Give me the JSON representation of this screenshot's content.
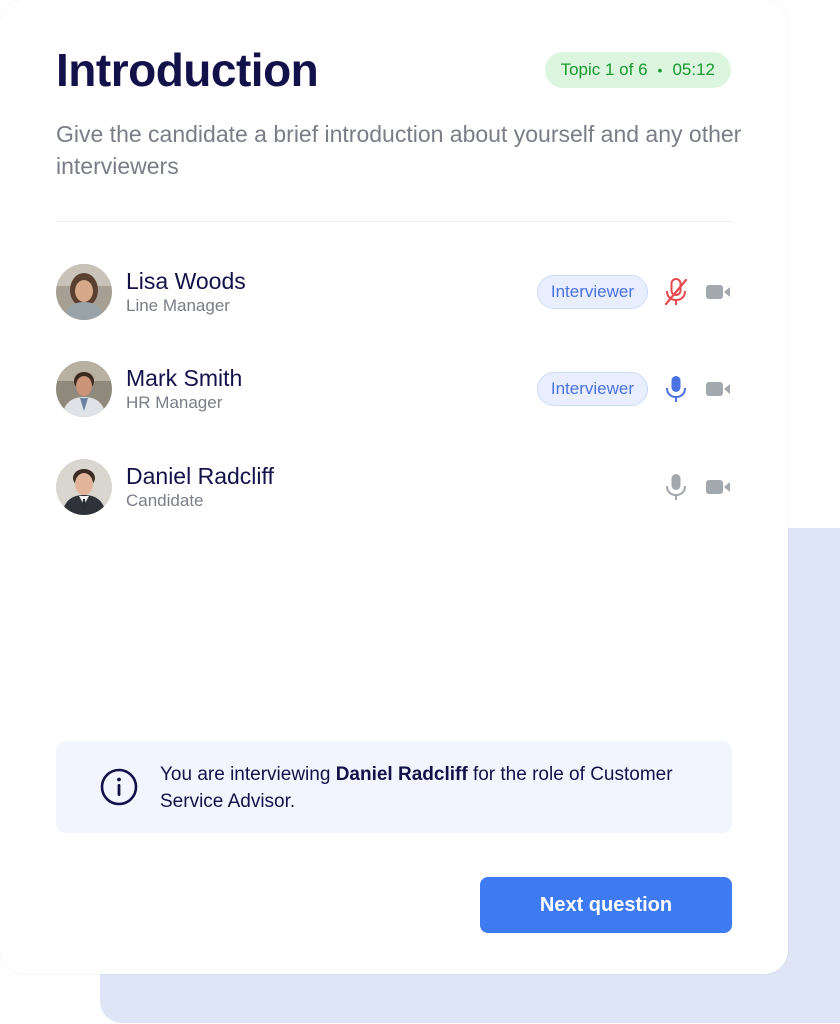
{
  "header": {
    "title": "Introduction",
    "topic": "Topic 1 of 6",
    "separator": "•",
    "timer": "05:12",
    "subtitle": "Give the candidate a brief introduction about yourself and any other interviewers"
  },
  "participants": [
    {
      "name": "Lisa Woods",
      "role": "Line Manager",
      "badge": "Interviewer",
      "mic": "muted",
      "camera": "on"
    },
    {
      "name": "Mark Smith",
      "role": "HR Manager",
      "badge": "Interviewer",
      "mic": "active",
      "camera": "on"
    },
    {
      "name": "Daniel Radcliff",
      "role": "Candidate",
      "badge": "",
      "mic": "idle",
      "camera": "on"
    }
  ],
  "info": {
    "prefix": "You are interviewing ",
    "candidate": "Daniel Radcliff",
    "middle": " for the role of ",
    "job_title": "Customer Service Advisor",
    "suffix": "."
  },
  "actions": {
    "next_label": "Next question"
  },
  "colors": {
    "title": "#12114a",
    "accent": "#3e7bf3",
    "topic_bg": "#dcf5de",
    "topic_text": "#1a9a2e",
    "badge_bg": "#e8eefd",
    "muted_mic": "#e5484d",
    "active_mic": "#4a72e0",
    "idle_icon": "#a3a7ae",
    "back_panel": "#dde5f6"
  }
}
